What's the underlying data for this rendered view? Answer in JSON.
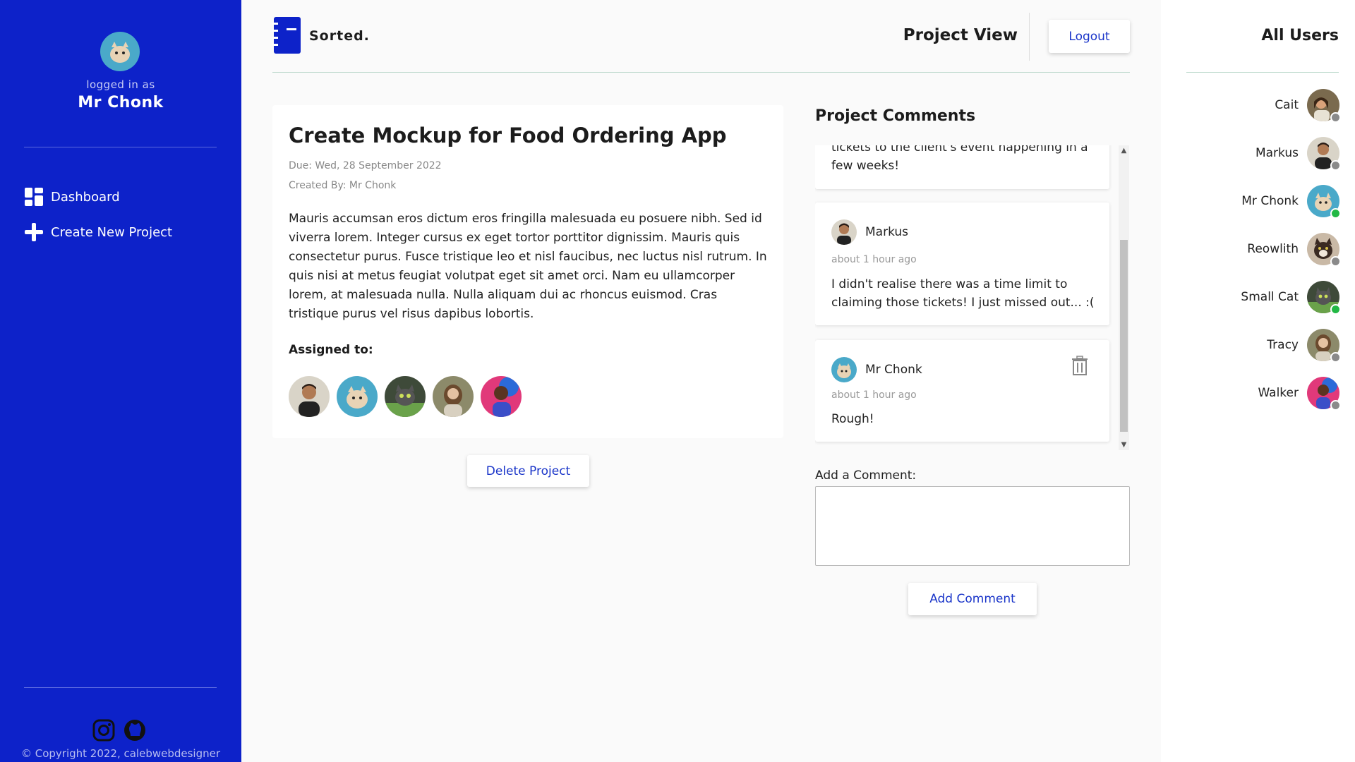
{
  "sidebar": {
    "logged_in_as": "logged in as",
    "user_name": "Mr Chonk",
    "nav": [
      {
        "label": "Dashboard",
        "icon": "dashboard-icon"
      },
      {
        "label": "Create New Project",
        "icon": "plus-icon"
      }
    ],
    "social": [
      "instagram-icon",
      "github-icon"
    ],
    "copyright": "© Copyright 2022, calebwebdesigner"
  },
  "header": {
    "brand": "Sorted.",
    "page_title": "Project View",
    "logout_label": "Logout"
  },
  "project": {
    "title": "Create Mockup for Food Ordering App",
    "due": "Due: Wed, 28 September 2022",
    "created_by": "Created By: Mr Chonk",
    "description": "Mauris accumsan eros dictum eros fringilla malesuada eu posuere nibh. Sed id viverra lorem. Integer cursus ex eget tortor porttitor dignissim. Mauris quis consectetur purus. Fusce tristique leo et nisl faucibus, nec luctus nisl rutrum. In quis nisi at metus feugiat volutpat eget sit amet orci. Nam eu ullamcorper lorem, at malesuada nulla. Nulla aliquam dui ac rhoncus euismod. Cras tristique purus vel risus dapibus lobortis.",
    "assigned_label": "Assigned to:",
    "delete_label": "Delete Project"
  },
  "comments": {
    "heading": "Project Comments",
    "items": [
      {
        "author": "",
        "time": "",
        "text": "tickets to the client's event happening in a few weeks!"
      },
      {
        "author": "Markus",
        "time": "about 1 hour ago",
        "text": "I didn't realise there was a time limit to claiming those tickets! I just missed out... :("
      },
      {
        "author": "Mr Chonk",
        "time": "about 1 hour ago",
        "text": "Rough!"
      }
    ],
    "add_label": "Add a Comment:",
    "add_button": "Add Comment",
    "input_value": ""
  },
  "users": {
    "heading": "All Users",
    "list": [
      {
        "name": "Cait",
        "online": false
      },
      {
        "name": "Markus",
        "online": false
      },
      {
        "name": "Mr Chonk",
        "online": true
      },
      {
        "name": "Reowlith",
        "online": false
      },
      {
        "name": "Small Cat",
        "online": true
      },
      {
        "name": "Tracy",
        "online": false
      },
      {
        "name": "Walker",
        "online": false
      }
    ]
  },
  "colors": {
    "sidebar": "#0d22c9",
    "accent": "#1a35c9",
    "online": "#22b845",
    "offline": "#8a8a8a"
  }
}
